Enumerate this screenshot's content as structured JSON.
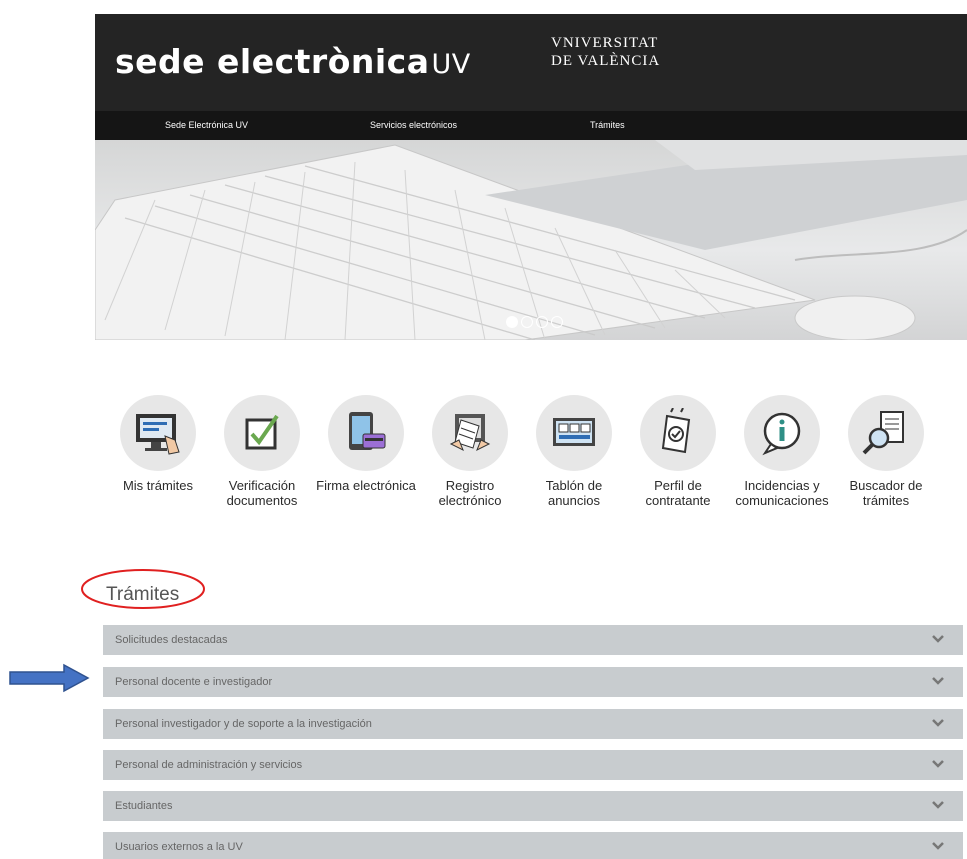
{
  "header": {
    "brand_main": "sede electrònica",
    "brand_suffix": "UV",
    "logo_line1": "VNIVERSITAT",
    "logo_line2": "DE VALÈNCIA"
  },
  "nav": {
    "items": [
      "Sede Electrónica UV",
      "Servicios electrónicos",
      "Trámites"
    ]
  },
  "carousel": {
    "slides": 4,
    "active": 1
  },
  "services": [
    {
      "label": "Mis trámites",
      "icon": "monitor-hand-icon"
    },
    {
      "label": "Verificación documentos",
      "icon": "checkbox-icon"
    },
    {
      "label": "Firma electrónica",
      "icon": "tablet-card-icon"
    },
    {
      "label": "Registro electrónico",
      "icon": "document-hands-icon"
    },
    {
      "label": "Tablón de anuncios",
      "icon": "board-icon"
    },
    {
      "label": "Perfil de contratante",
      "icon": "contract-icon"
    },
    {
      "label": "Incidencias y comunicaciones",
      "icon": "info-bubble-icon"
    },
    {
      "label": "Buscador de trámites",
      "icon": "search-doc-icon"
    }
  ],
  "tramites": {
    "title": "Trámites",
    "sections": [
      "Solicitudes destacadas",
      "Personal docente e investigador",
      "Personal investigador y de soporte a la investigación",
      "Personal de administración y servicios",
      "Estudiantes",
      "Usuarios externos a la UV"
    ]
  },
  "colors": {
    "header_bg": "#242424",
    "nav_bg": "#151515",
    "accordion_bg": "#c8cccf",
    "annotation_oval": "#e02020",
    "annotation_arrow": "#4472c4"
  }
}
